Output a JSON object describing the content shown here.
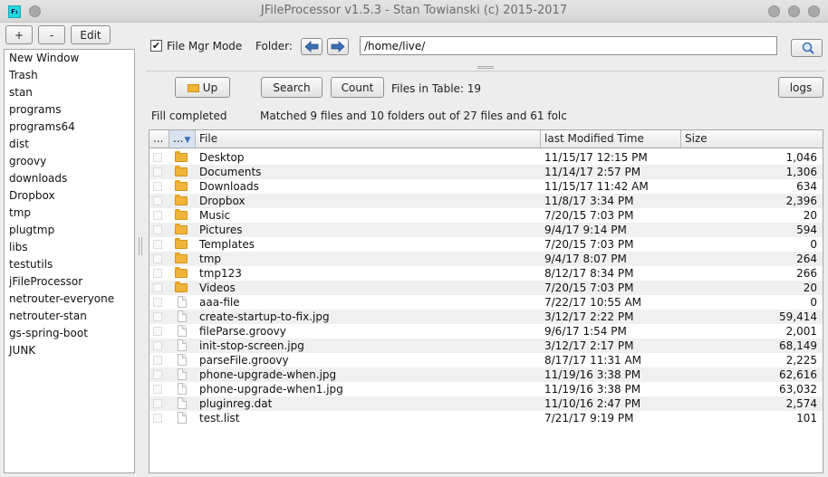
{
  "window": {
    "title": "JFileProcessor v1.5.3 - Stan Towianski (c) 2015-2017",
    "app_icon_text": "F₁"
  },
  "left_toolbar": {
    "add_label": "+",
    "remove_label": "-",
    "edit_label": "Edit"
  },
  "bookmarks": [
    "New Window",
    "Trash",
    "stan",
    "programs",
    "programs64",
    "dist",
    "groovy",
    "downloads",
    "Dropbox",
    "tmp",
    "plugtmp",
    "libs",
    "testutils",
    "jFileProcessor",
    "netrouter-everyone",
    "netrouter-stan",
    "gs-spring-boot",
    "JUNK"
  ],
  "top": {
    "file_mgr_mode_label": "File Mgr Mode",
    "file_mgr_mode_checked": "✔",
    "folder_label": "Folder:",
    "folder_value": "/home/live/"
  },
  "actions": {
    "up_label": "Up",
    "search_label": "Search",
    "count_label": "Count",
    "files_in_table": "Files in Table: 19",
    "logs_label": "logs"
  },
  "status": {
    "fill": "Fill completed",
    "matched": "Matched 9 files and 10 folders out of 27 files and 61 folc"
  },
  "table": {
    "columns": [
      "...",
      "...",
      "File",
      "last Modified Time",
      "Size"
    ],
    "rows": [
      {
        "type": "folder",
        "name": "Desktop",
        "modified": "11/15/17 12:15 PM",
        "size": "1,046"
      },
      {
        "type": "folder",
        "name": "Documents",
        "modified": "11/14/17 2:57 PM",
        "size": "1,306"
      },
      {
        "type": "folder",
        "name": "Downloads",
        "modified": "11/15/17 11:42 AM",
        "size": "634"
      },
      {
        "type": "folder",
        "name": "Dropbox",
        "modified": "11/8/17 3:34 PM",
        "size": "2,396"
      },
      {
        "type": "folder",
        "name": "Music",
        "modified": "7/20/15 7:03 PM",
        "size": "20"
      },
      {
        "type": "folder",
        "name": "Pictures",
        "modified": "9/4/17 9:14 PM",
        "size": "594"
      },
      {
        "type": "folder",
        "name": "Templates",
        "modified": "7/20/15 7:03 PM",
        "size": "0"
      },
      {
        "type": "folder",
        "name": "tmp",
        "modified": "9/4/17 8:07 PM",
        "size": "264"
      },
      {
        "type": "folder",
        "name": "tmp123",
        "modified": "8/12/17 8:34 PM",
        "size": "266"
      },
      {
        "type": "folder",
        "name": "Videos",
        "modified": "7/20/15 7:03 PM",
        "size": "20"
      },
      {
        "type": "file",
        "name": "aaa-file",
        "modified": "7/22/17 10:55 AM",
        "size": "0"
      },
      {
        "type": "file",
        "name": "create-startup-to-fix.jpg",
        "modified": "3/12/17 2:22 PM",
        "size": "59,414"
      },
      {
        "type": "file",
        "name": "fileParse.groovy",
        "modified": "9/6/17 1:54 PM",
        "size": "2,001"
      },
      {
        "type": "file",
        "name": "init-stop-screen.jpg",
        "modified": "3/12/17 2:17 PM",
        "size": "68,149"
      },
      {
        "type": "file",
        "name": "parseFile.groovy",
        "modified": "8/17/17 11:31 AM",
        "size": "2,225"
      },
      {
        "type": "file",
        "name": "phone-upgrade-when.jpg",
        "modified": "11/19/16 3:38 PM",
        "size": "62,616"
      },
      {
        "type": "file",
        "name": "phone-upgrade-when1.jpg",
        "modified": "11/19/16 3:38 PM",
        "size": "63,032"
      },
      {
        "type": "file",
        "name": "pluginreg.dat",
        "modified": "11/10/16 2:47 PM",
        "size": "2,574"
      },
      {
        "type": "file",
        "name": "test.list",
        "modified": "7/21/17 9:19 PM",
        "size": "101"
      }
    ]
  },
  "colors": {
    "folder": "#f0b43a",
    "app_icon": "#23d7e0",
    "nav_arrow": "#3b6fb5"
  }
}
